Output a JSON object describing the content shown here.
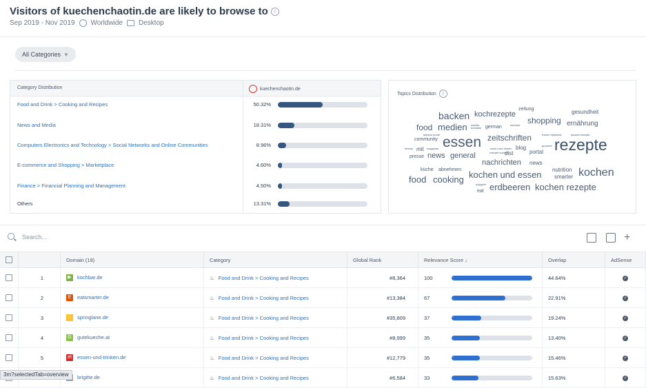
{
  "header": {
    "title": "Visitors of kuechenchaotin.de are likely to browse to",
    "date_range": "Sep 2019 - Nov 2019",
    "region": "Worldwide",
    "device": "Desktop"
  },
  "filter": {
    "label": "All Categories"
  },
  "category_distribution": {
    "header_left": "Category Distribution",
    "header_right": "kuechenchaotin.de",
    "rows": [
      {
        "label": "Food and Drink > Cooking and Recipes",
        "pct": "50.32%",
        "value": 50.32
      },
      {
        "label": "News and Media",
        "pct": "18.31%",
        "value": 18.31
      },
      {
        "label": "Computers Electronics and Technology > Social Networks and Online Communities",
        "pct": "8.96%",
        "value": 8.96
      },
      {
        "label": "E-commerce and Shopping > Marketplace",
        "pct": "4.60%",
        "value": 4.6
      },
      {
        "label": "Finance > Financial Planning and Management",
        "pct": "4.50%",
        "value": 4.5
      },
      {
        "label": "Others",
        "pct": "13.31%",
        "value": 13.31
      }
    ]
  },
  "topics": {
    "title": "Topics Distribution",
    "words": [
      "backen",
      "kochrezepte",
      "zeitung",
      "gesundheit",
      "food",
      "medien",
      "soziale kontakte",
      "german",
      "sommer",
      "shopping",
      "ernährung",
      "essen",
      "zeitschriften",
      "community",
      "rezepte",
      "fashion mode",
      "mit",
      "magazine",
      "presse",
      "news",
      "general",
      "blog",
      "dist",
      "portal",
      "nachrichten",
      "news",
      "küche",
      "abnehmen",
      "nutrition",
      "smarter",
      "kochen",
      "food",
      "cooking",
      "kochen und essen",
      "magazin",
      "eat",
      "erdbeeren",
      "kochen rezepte",
      "beauty",
      "essen und trinken",
      "rezepte kochen",
      "frauen frühstück",
      "backen rezepte",
      "gourmet"
    ]
  },
  "search": {
    "placeholder": "Search..."
  },
  "table": {
    "headers": {
      "domain": "Domain (18)",
      "category": "Category",
      "rank": "Global Rank",
      "relevance": "Relevance Score",
      "overlap": "Overlap",
      "adsense": "AdSense"
    },
    "rows": [
      {
        "n": "1",
        "domain": "kochbar.de",
        "category": "Food and Drink > Cooking and Recipes",
        "rank": "#8,364",
        "score": "100",
        "score_value": 100,
        "overlap": "44.64%",
        "favicon_color": "#7cb342",
        "favicon_char": "▶"
      },
      {
        "n": "2",
        "domain": "eatsmarter.de",
        "category": "Food and Drink > Cooking and Recipes",
        "rank": "#13,384",
        "score": "67",
        "score_value": 67,
        "overlap": "22.91%",
        "favicon_color": "#e65100",
        "favicon_char": "E"
      },
      {
        "n": "3",
        "domain": "springlane.de",
        "category": "Food and Drink > Cooking and Recipes",
        "rank": "#35,809",
        "score": "37",
        "score_value": 37,
        "overlap": "19.24%",
        "favicon_color": "#fbc02d",
        "favicon_char": "○"
      },
      {
        "n": "4",
        "domain": "gutekueche.at",
        "category": "Food and Drink > Cooking and Recipes",
        "rank": "#8,999",
        "score": "35",
        "score_value": 35,
        "overlap": "13.40%",
        "favicon_color": "#8bc34a",
        "favicon_char": "G"
      },
      {
        "n": "5",
        "domain": "essen-und-trinken.de",
        "category": "Food and Drink > Cooking and Recipes",
        "rank": "#12,779",
        "score": "35",
        "score_value": 35,
        "overlap": "15.46%",
        "favicon_color": "#d32f2f",
        "favicon_char": "et"
      },
      {
        "n": "6",
        "domain": "brigitte.de",
        "category": "Food and Drink > Cooking and Recipes",
        "rank": "#6,584",
        "score": "33",
        "score_value": 33,
        "overlap": "15.63%",
        "favicon_color": "#90a4ae",
        "favicon_char": ""
      }
    ]
  },
  "status_bar": {
    "text": "3m?selectedTab=overview"
  },
  "colors": {
    "bar": "#35577f",
    "relevance_bar": "#2f6fcf",
    "link": "#2d6fb8"
  }
}
